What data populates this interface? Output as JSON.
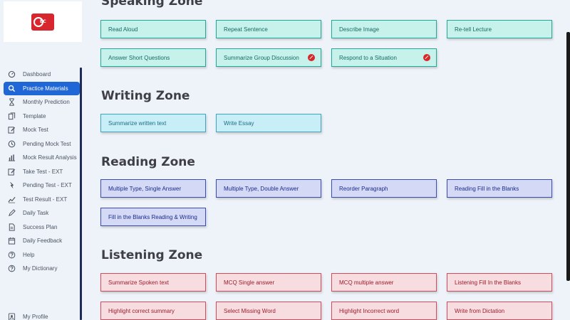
{
  "nav": {
    "items": [
      {
        "label": "Dashboard",
        "icon": "dashboard-icon"
      },
      {
        "label": "Practice Materials",
        "icon": "search-icon",
        "active": true
      },
      {
        "label": "Monthly Prediction",
        "icon": "hourglass-icon"
      },
      {
        "label": "Template",
        "icon": "documents-icon"
      },
      {
        "label": "Mock Test",
        "icon": "edit-icon"
      },
      {
        "label": "Pending Mock Test",
        "icon": "clock-icon"
      },
      {
        "label": "Mock Result Analysis",
        "icon": "bar-chart-icon"
      },
      {
        "label": "Take Test - EXT",
        "icon": "edit-icon"
      },
      {
        "label": "Pending Test - EXT",
        "icon": "pending-icon"
      },
      {
        "label": "Test Result - EXT",
        "icon": "line-chart-icon"
      },
      {
        "label": "Daily Task",
        "icon": "pen-icon"
      },
      {
        "label": "Success Plan",
        "icon": "document-icon"
      },
      {
        "label": "Daily Feedback",
        "icon": "calendar-icon"
      },
      {
        "label": "Help",
        "icon": "help-icon"
      },
      {
        "label": "My Dictionary",
        "icon": "help-icon"
      }
    ],
    "profile": "My Profile"
  },
  "zones": [
    {
      "title": "Speaking Zone",
      "kind": "speak",
      "items": [
        {
          "label": "Read Aloud"
        },
        {
          "label": "Repeat Sentence"
        },
        {
          "label": "Describe Image"
        },
        {
          "label": "Re-tell Lecture"
        },
        {
          "label": "Answer Short Questions"
        },
        {
          "label": "Summarize Group Discussion",
          "badge": true
        },
        {
          "label": "Respond to a Situation",
          "badge": true
        }
      ]
    },
    {
      "title": "Writing Zone",
      "kind": "write",
      "items": [
        {
          "label": "Summarize written text"
        },
        {
          "label": "Write Essay"
        }
      ]
    },
    {
      "title": "Reading Zone",
      "kind": "read",
      "items": [
        {
          "label": "Multiple Type, Single Answer"
        },
        {
          "label": "Multiple Type, Double Answer"
        },
        {
          "label": "Reorder Paragraph"
        },
        {
          "label": "Reading Fill in the Blanks"
        },
        {
          "label": "Fill in the Blanks Reading & Writing"
        }
      ]
    },
    {
      "title": "Listening Zone",
      "kind": "listen",
      "items": [
        {
          "label": "Summarize Spoken text"
        },
        {
          "label": "MCQ Single answer"
        },
        {
          "label": "MCQ multiple answer"
        },
        {
          "label": "Listening Fill In the Blanks"
        },
        {
          "label": "Highlight correct summary"
        },
        {
          "label": "Select Missing Word"
        },
        {
          "label": "Highlight Incorrect word"
        },
        {
          "label": "Write from Dictation"
        }
      ]
    }
  ]
}
